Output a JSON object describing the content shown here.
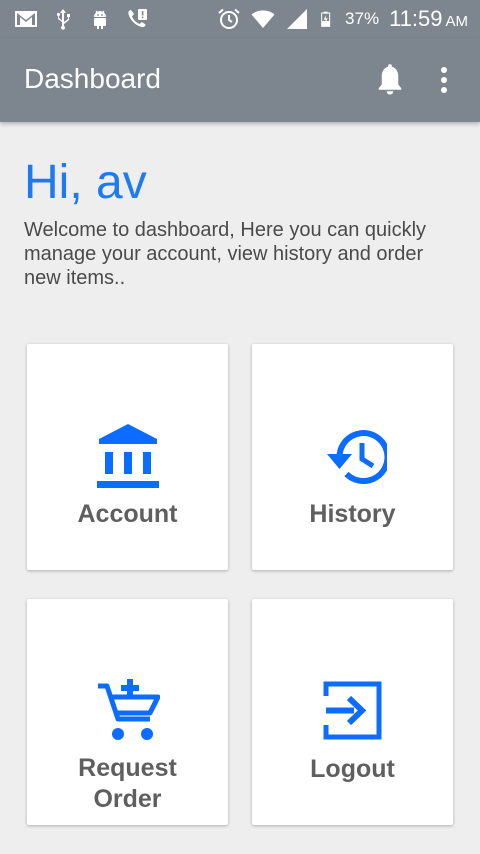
{
  "status_bar": {
    "left_icons": [
      "gmail-icon",
      "usb-icon",
      "android-icon",
      "missed-call-icon"
    ],
    "right_icons": [
      "alarm-icon",
      "wifi-icon",
      "signal-icon",
      "battery-icon"
    ],
    "battery_percent": "37%",
    "time": "11:59",
    "ampm": "AM"
  },
  "app_bar": {
    "title": "Dashboard",
    "icons": [
      "bell-icon",
      "more-vert-icon"
    ]
  },
  "main": {
    "greeting": "Hi, av",
    "welcome_text": "Welcome to dashboard, Here you can quickly manage your account, view history and order new items.."
  },
  "tiles": [
    {
      "label": "Account",
      "icon": "bank-icon"
    },
    {
      "label": "History",
      "icon": "history-icon"
    },
    {
      "label": "Request\nOrder",
      "icon": "add-shopping-cart-icon"
    },
    {
      "label": "Logout",
      "icon": "exit-icon"
    }
  ],
  "colors": {
    "app_bar": "#7d868e",
    "accent": "#1e7bef",
    "icon_blue": "#0b6cff",
    "tile_label": "#5f5f5f",
    "background": "#eeeeee"
  }
}
